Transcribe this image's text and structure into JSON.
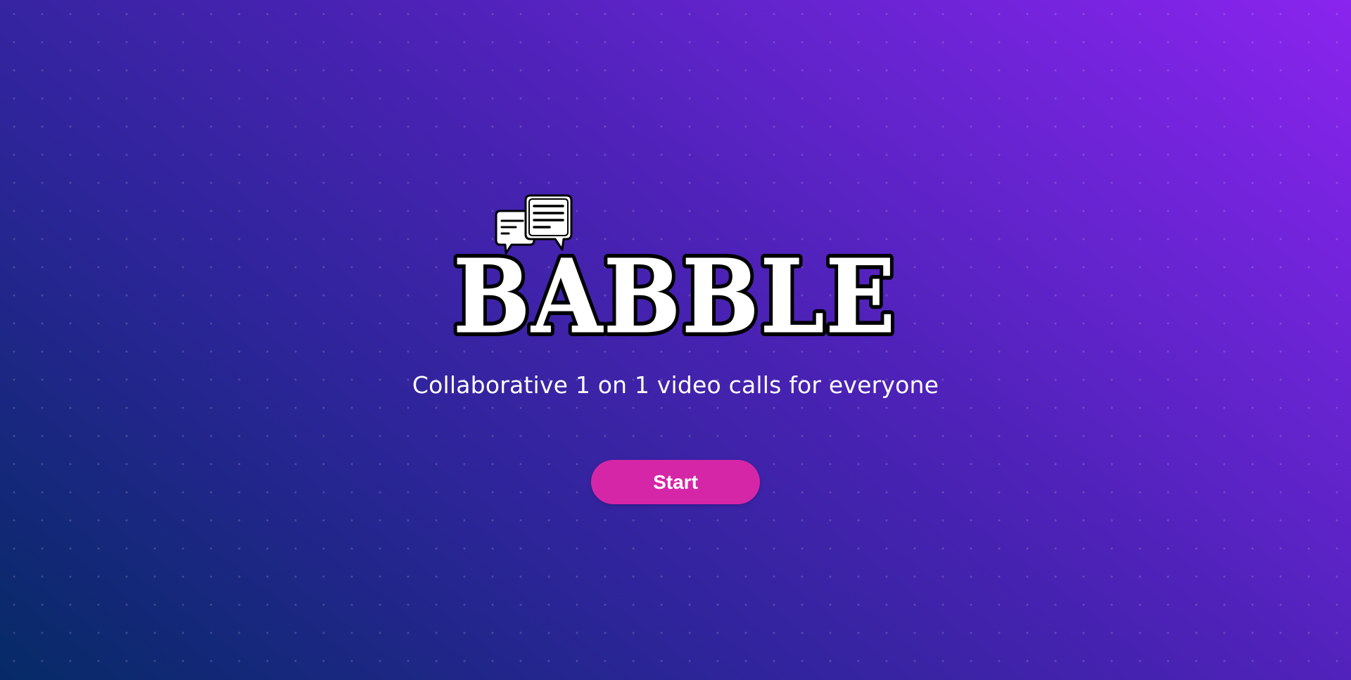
{
  "app": {
    "logo_text": "BABBLE",
    "logo_icon": "chat-bubbles-icon",
    "tagline": "Collaborative 1 on 1 video calls for everyone",
    "start_label": "Start"
  },
  "colors": {
    "background_gradient": [
      "#062a66",
      "#2a2596",
      "#4a22b4",
      "#6d24d6",
      "#8a24ee"
    ],
    "button": "#d626a8",
    "text": "#ffffff"
  }
}
